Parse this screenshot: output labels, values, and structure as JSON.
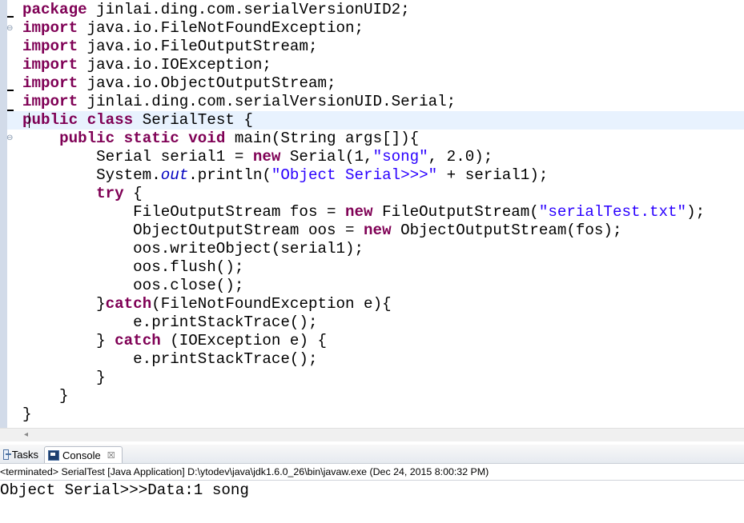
{
  "editor": {
    "lines": [
      [
        {
          "t": "kw",
          "v": "package"
        },
        {
          "t": "plain",
          "v": " jinlai.ding.com.serialVersionUID2;"
        }
      ],
      [
        {
          "t": "kw",
          "v": "import"
        },
        {
          "t": "plain",
          "v": " java.io.FileNotFoundException;"
        }
      ],
      [
        {
          "t": "kw",
          "v": "import"
        },
        {
          "t": "plain",
          "v": " java.io.FileOutputStream;"
        }
      ],
      [
        {
          "t": "kw",
          "v": "import"
        },
        {
          "t": "plain",
          "v": " java.io.IOException;"
        }
      ],
      [
        {
          "t": "kw",
          "v": "import"
        },
        {
          "t": "plain",
          "v": " java.io.ObjectOutputStream;"
        }
      ],
      [
        {
          "t": "kw",
          "v": "import"
        },
        {
          "t": "plain",
          "v": " jinlai.ding.com.serialVersionUID.Serial;"
        }
      ],
      [
        {
          "t": "kw",
          "v": "public"
        },
        {
          "t": "plain",
          "v": " "
        },
        {
          "t": "kw",
          "v": "class"
        },
        {
          "t": "plain",
          "v": " SerialTest {"
        }
      ],
      [
        {
          "t": "plain",
          "v": "    "
        },
        {
          "t": "kw",
          "v": "public"
        },
        {
          "t": "plain",
          "v": " "
        },
        {
          "t": "kw",
          "v": "static"
        },
        {
          "t": "plain",
          "v": " "
        },
        {
          "t": "kw",
          "v": "void"
        },
        {
          "t": "plain",
          "v": " main(String args[]){"
        }
      ],
      [
        {
          "t": "plain",
          "v": "        Serial serial1 = "
        },
        {
          "t": "kw",
          "v": "new"
        },
        {
          "t": "plain",
          "v": " Serial(1,"
        },
        {
          "t": "str",
          "v": "\"song\""
        },
        {
          "t": "plain",
          "v": ", 2.0);"
        }
      ],
      [
        {
          "t": "plain",
          "v": "        System."
        },
        {
          "t": "fld",
          "v": "out"
        },
        {
          "t": "plain",
          "v": ".println("
        },
        {
          "t": "str",
          "v": "\"Object Serial>>>\""
        },
        {
          "t": "plain",
          "v": " + serial1);"
        }
      ],
      [
        {
          "t": "plain",
          "v": "        "
        },
        {
          "t": "kw",
          "v": "try"
        },
        {
          "t": "plain",
          "v": " {"
        }
      ],
      [
        {
          "t": "plain",
          "v": "            FileOutputStream fos = "
        },
        {
          "t": "kw",
          "v": "new"
        },
        {
          "t": "plain",
          "v": " FileOutputStream("
        },
        {
          "t": "str",
          "v": "\"serialTest.txt\""
        },
        {
          "t": "plain",
          "v": ");"
        }
      ],
      [
        {
          "t": "plain",
          "v": "            ObjectOutputStream oos = "
        },
        {
          "t": "kw",
          "v": "new"
        },
        {
          "t": "plain",
          "v": " ObjectOutputStream(fos);"
        }
      ],
      [
        {
          "t": "plain",
          "v": "            oos.writeObject(serial1);"
        }
      ],
      [
        {
          "t": "plain",
          "v": "            oos.flush();"
        }
      ],
      [
        {
          "t": "plain",
          "v": "            oos.close();"
        }
      ],
      [
        {
          "t": "plain",
          "v": "        }"
        },
        {
          "t": "kw",
          "v": "catch"
        },
        {
          "t": "plain",
          "v": "(FileNotFoundException e){"
        }
      ],
      [
        {
          "t": "plain",
          "v": "            e.printStackTrace();"
        }
      ],
      [
        {
          "t": "plain",
          "v": "        } "
        },
        {
          "t": "kw",
          "v": "catch"
        },
        {
          "t": "plain",
          "v": " (IOException e) {"
        }
      ],
      [
        {
          "t": "plain",
          "v": "            e.printStackTrace();"
        }
      ],
      [
        {
          "t": "plain",
          "v": "        }"
        }
      ],
      [
        {
          "t": "plain",
          "v": "    }"
        }
      ],
      [
        {
          "t": "plain",
          "v": "}"
        }
      ]
    ]
  },
  "tabs": {
    "tasks_label": "Tasks",
    "console_label": "Console",
    "tasks_icon": "tasks-icon",
    "console_icon": "console-icon",
    "close_glyph": "☒"
  },
  "console": {
    "status": "<terminated> SerialTest [Java Application] D:\\ytodev\\java\\jdk1.6.0_26\\bin\\javaw.exe (Dec 24, 2015 8:00:32 PM)",
    "output": "Object Serial>>>Data:1 song"
  },
  "colors": {
    "keyword": "#7f0055",
    "string": "#2a00ff",
    "static_field": "#0000c0",
    "current_line": "#e8f2fe"
  }
}
